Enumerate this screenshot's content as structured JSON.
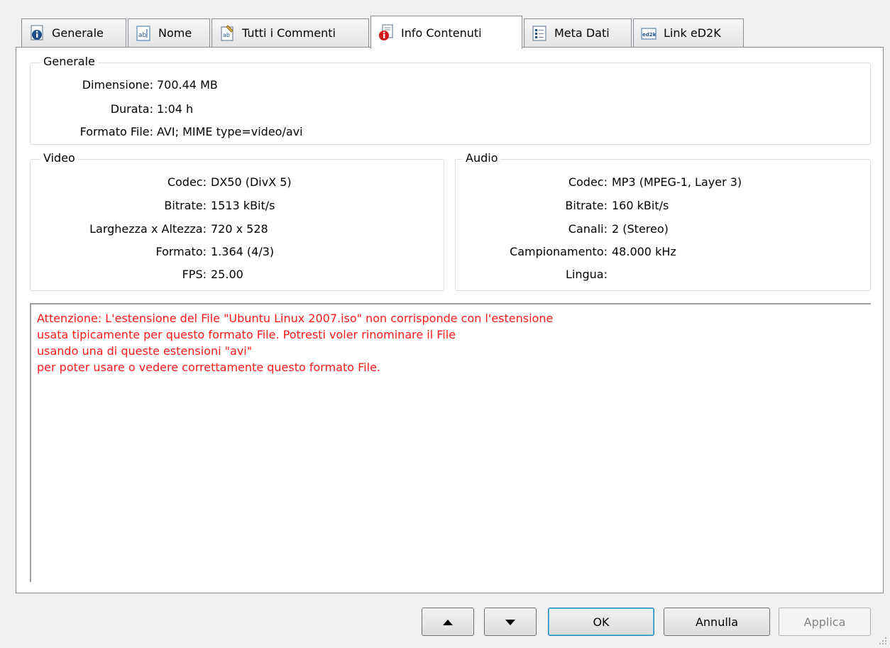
{
  "tabs": [
    {
      "label": "Generale",
      "icon": "info-page-icon"
    },
    {
      "label": "Nome",
      "icon": "ab-text-icon"
    },
    {
      "label": "Tutti i Commenti",
      "icon": "comments-icon"
    },
    {
      "label": "Info Contenuti",
      "icon": "content-info-icon",
      "active": true
    },
    {
      "label": "Meta Dati",
      "icon": "metadata-icon"
    },
    {
      "label": "Link eD2K",
      "icon": "ed2k-icon"
    }
  ],
  "general": {
    "title": "Generale",
    "rows": [
      {
        "label": "Dimensione:",
        "value": "700.44 MB"
      },
      {
        "label": "Durata:",
        "value": "1:04 h"
      },
      {
        "label": "Formato File:",
        "value": "AVI; MIME type=video/avi"
      }
    ]
  },
  "video": {
    "title": "Video",
    "rows": [
      {
        "label": "Codec:",
        "value": "DX50 (DivX 5)"
      },
      {
        "label": "Bitrate:",
        "value": "1513 kBit/s"
      },
      {
        "label": "Larghezza x Altezza:",
        "value": "720 x 528"
      },
      {
        "label": "Formato:",
        "value": "1.364  (4/3)"
      },
      {
        "label": "FPS:",
        "value": "25.00"
      }
    ]
  },
  "audio": {
    "title": "Audio",
    "rows": [
      {
        "label": "Codec:",
        "value": "MP3 (MPEG-1, Layer 3)"
      },
      {
        "label": "Bitrate:",
        "value": "160 kBit/s"
      },
      {
        "label": "Canali:",
        "value": "2 (Stereo)"
      },
      {
        "label": "Campionamento:",
        "value": "48.000 kHz"
      },
      {
        "label": "Lingua:",
        "value": ""
      }
    ]
  },
  "warning": {
    "lines": [
      "Attenzione: L'estensione del File \"Ubuntu Linux 2007.iso\" non corrisponde con l'estensione",
      "usata tipicamente per questo formato File. Potresti voler rinominare il File",
      "usando una di queste estensioni \"avi\"",
      "per poter usare o vedere correttamente questo formato File."
    ],
    "color": "#ff1a1a"
  },
  "buttons": {
    "up_icon": "triangle-up-icon",
    "down_icon": "triangle-down-icon",
    "ok": "OK",
    "cancel": "Annulla",
    "apply": "Applica"
  }
}
